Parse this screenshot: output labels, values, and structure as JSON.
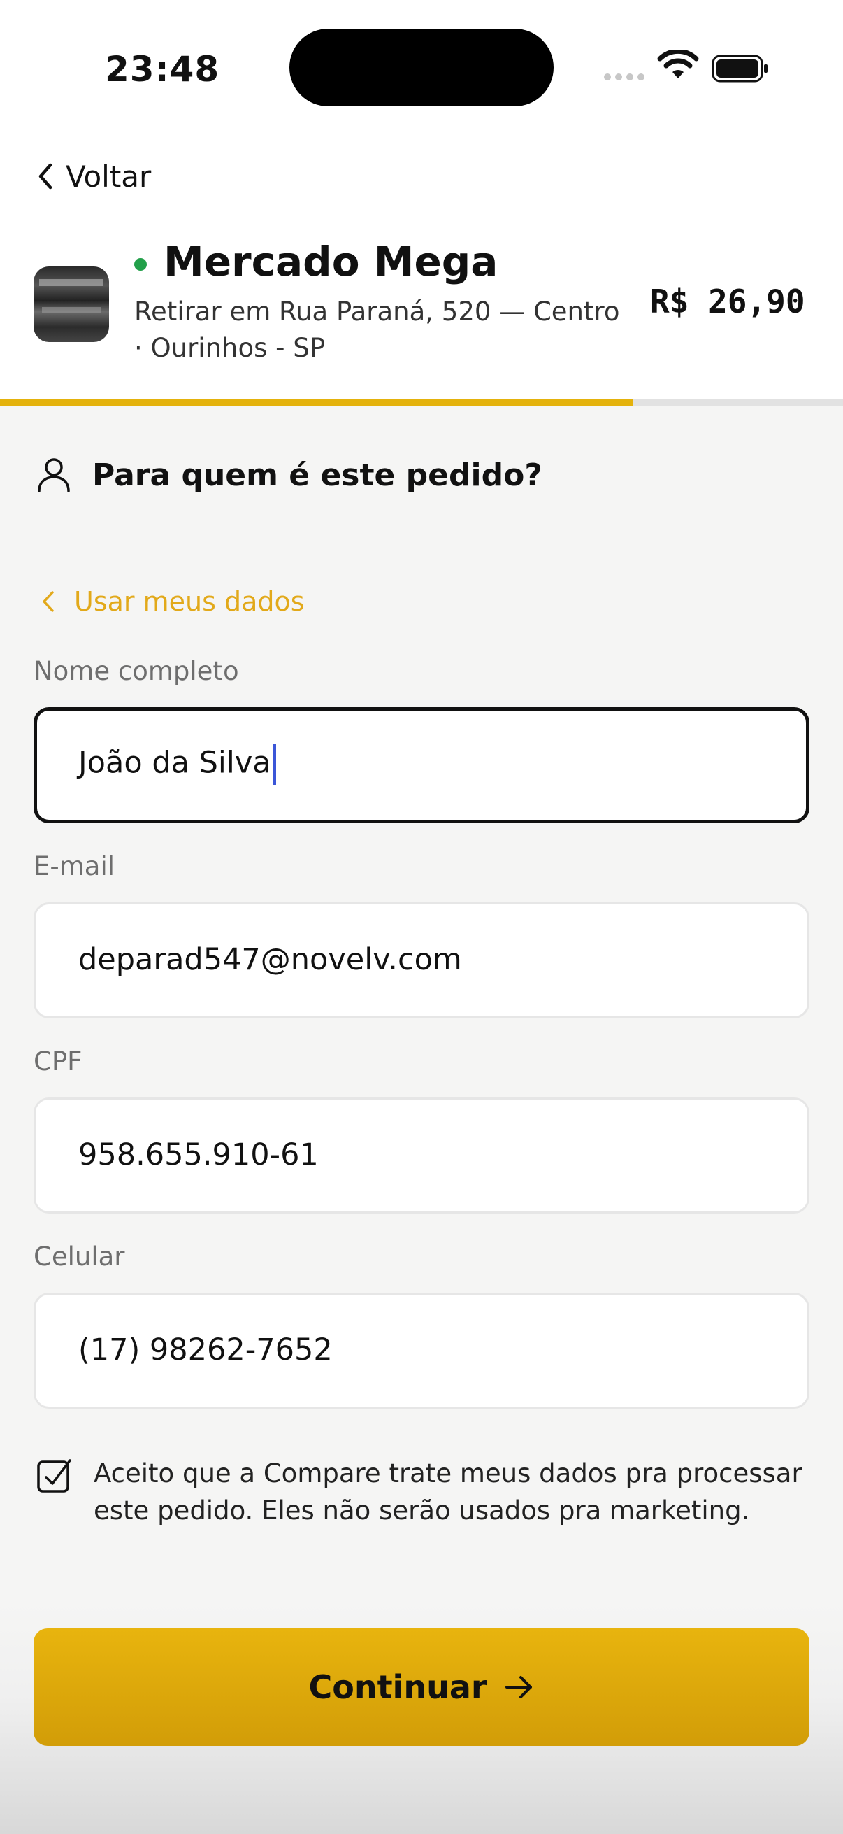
{
  "status_bar": {
    "time": "23:48"
  },
  "header": {
    "back_label": "Voltar",
    "store_name": "Mercado Mega",
    "store_address": "Retirar em Rua Paraná, 520 — Centro · Ourinhos - SP",
    "price": "R$ 26,90",
    "progress_fraction": 0.75
  },
  "section": {
    "title": "Para quem é este pedido?"
  },
  "use_my_data": "Usar meus dados",
  "form": {
    "name": {
      "label": "Nome completo",
      "value": "João da Silva"
    },
    "email": {
      "label": "E-mail",
      "value": "deparad547@novelv.com"
    },
    "cpf": {
      "label": "CPF",
      "value": "958.655.910-61"
    },
    "phone": {
      "label": "Celular",
      "value": "(17) 98262-7652"
    }
  },
  "consent": {
    "checked": true,
    "text": "Aceito que a Compare trate meus dados pra processar este pedido. Eles não serão usados pra marketing."
  },
  "continue_label": "Continuar",
  "colors": {
    "accent": "#e4b20c",
    "link": "#e2a91a",
    "online": "#22a04a",
    "caret": "#3b56d8"
  },
  "icons": {
    "back": "chevron-left-icon",
    "person": "person-icon",
    "use_data": "chevron-left-icon",
    "checkbox": "checkbox-checked-icon",
    "continue": "arrow-right-icon"
  }
}
